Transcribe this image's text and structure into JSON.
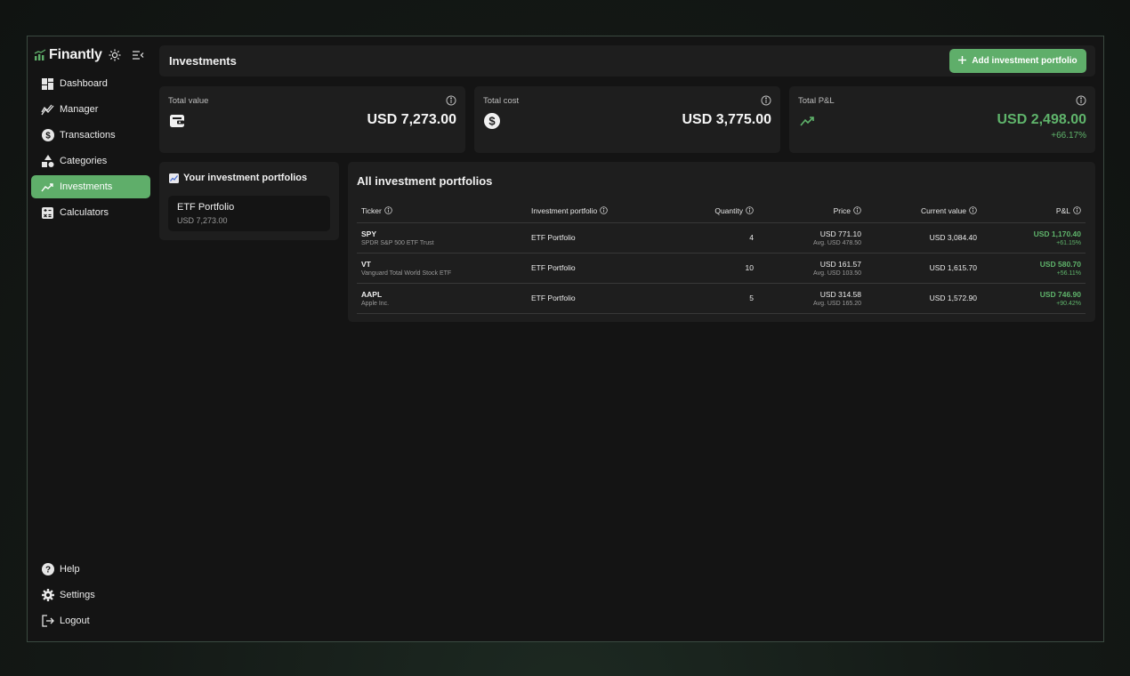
{
  "brand": {
    "name": "Finantly"
  },
  "nav": {
    "items": [
      {
        "label": "Dashboard",
        "icon": "dashboard-icon"
      },
      {
        "label": "Manager",
        "icon": "manager-chart-icon"
      },
      {
        "label": "Transactions",
        "icon": "dollar-coin-icon"
      },
      {
        "label": "Categories",
        "icon": "shapes-icon"
      },
      {
        "label": "Investments",
        "icon": "trending-up-icon",
        "active": true
      },
      {
        "label": "Calculators",
        "icon": "calculator-icon"
      }
    ],
    "bottom": [
      {
        "label": "Help",
        "icon": "help-icon"
      },
      {
        "label": "Settings",
        "icon": "gear-icon"
      },
      {
        "label": "Logout",
        "icon": "logout-icon"
      }
    ]
  },
  "header": {
    "title": "Investments",
    "add_button": "Add investment portfolio"
  },
  "stats": {
    "total_value": {
      "label": "Total value",
      "value": "USD 7,273.00"
    },
    "total_cost": {
      "label": "Total cost",
      "value": "USD 3,775.00"
    },
    "total_pl": {
      "label": "Total P&L",
      "value": "USD 2,498.00",
      "change": "+66.17%"
    }
  },
  "portfolios": {
    "heading": "Your investment portfolios",
    "items": [
      {
        "name": "ETF Portfolio",
        "value": "USD 7,273.00"
      }
    ]
  },
  "table": {
    "title": "All investment portfolios",
    "columns": [
      "Ticker",
      "Investment portfolio",
      "Quantity",
      "Price",
      "Current value",
      "P&L"
    ],
    "rows": [
      {
        "ticker": "SPY",
        "name": "SPDR S&P 500 ETF Trust",
        "portfolio": "ETF Portfolio",
        "quantity": "4",
        "price": "USD 771.10",
        "avg": "Avg. USD 478.50",
        "current": "USD 3,084.40",
        "pl": "USD 1,170.40",
        "pl_pct": "+61.15%"
      },
      {
        "ticker": "VT",
        "name": "Vanguard Total World Stock ETF",
        "portfolio": "ETF Portfolio",
        "quantity": "10",
        "price": "USD 161.57",
        "avg": "Avg. USD 103.50",
        "current": "USD 1,615.70",
        "pl": "USD 580.70",
        "pl_pct": "+56.11%"
      },
      {
        "ticker": "AAPL",
        "name": "Apple Inc.",
        "portfolio": "ETF Portfolio",
        "quantity": "5",
        "price": "USD 314.58",
        "avg": "Avg. USD 165.20",
        "current": "USD 1,572.90",
        "pl": "USD 746.90",
        "pl_pct": "+90.42%"
      }
    ]
  },
  "colors": {
    "accent": "#5fae6a",
    "positive": "#5fb46b",
    "panel": "#1e1e1e",
    "app_bg": "#141414"
  }
}
